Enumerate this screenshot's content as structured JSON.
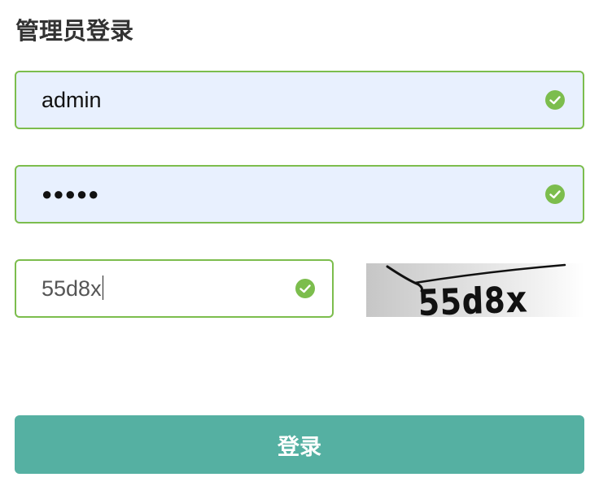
{
  "page": {
    "title": "管理员登录"
  },
  "form": {
    "username": {
      "value": "admin",
      "status_icon": "check-circle-icon"
    },
    "password": {
      "masked_value": "●●●●●",
      "status_icon": "check-circle-icon"
    },
    "captcha": {
      "value": "55d8x",
      "status_icon": "check-circle-icon",
      "image_text": "55d8x"
    },
    "submit_label": "登录"
  },
  "colors": {
    "valid_border": "#7cbd4d",
    "autofill_background": "#e8f0fe",
    "button_background": "#55b0a2",
    "title_text": "#333333"
  }
}
